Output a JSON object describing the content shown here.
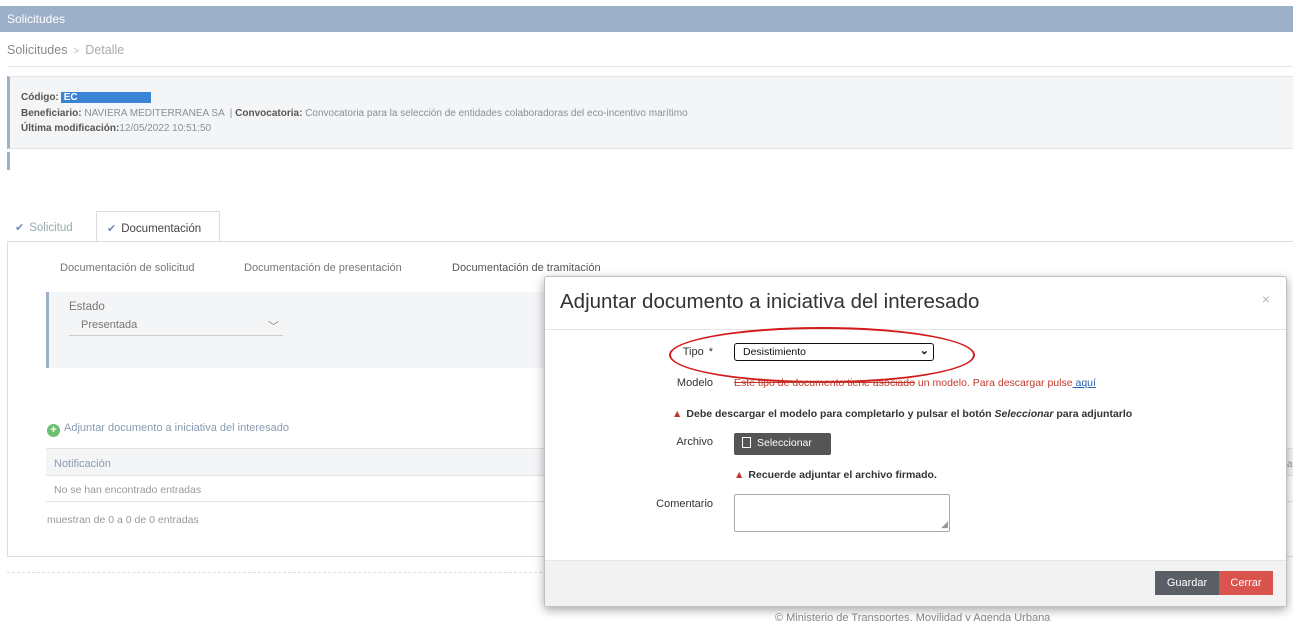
{
  "header": {
    "title": "Solicitudes"
  },
  "breadcrumb": {
    "root": "Solicitudes",
    "separator": ">",
    "current": "Detalle"
  },
  "info": {
    "codigo_label": "Código:",
    "codigo_value": "EC",
    "beneficiario_label": "Beneficiario:",
    "beneficiario_value": "NAVIERA MEDITERRANEA SA",
    "convocatoria_sep": "|",
    "convocatoria_label": "Convocatoria:",
    "convocatoria_value": "Convocatoria para la selección de entidades colaboradoras del eco-incentivo marítimo",
    "modificacion_label": "Última modificación:",
    "modificacion_value": "12/05/2022 10:51:50"
  },
  "tabs": [
    {
      "label": "Solicitud"
    },
    {
      "label": "Documentación"
    }
  ],
  "subtabs": [
    "Documentación de solicitud",
    "Documentación de presentación",
    "Documentación de tramitación"
  ],
  "estado": {
    "label": "Estado",
    "value": "Presentada"
  },
  "attach_link": "Adjuntar documento a iniciativa del interesado",
  "table": {
    "column": "Notificación",
    "empty": "No se han encontrado entradas",
    "info": "muestran de 0 a 0 de 0 entradas",
    "clipped_right": "a"
  },
  "footer": "© Ministerio de Transportes, Movilidad y Agenda Urbana",
  "modal": {
    "title": "Adjuntar documento a iniciativa del interesado",
    "close": "×",
    "tipo_label": "Tipo",
    "required_mark": "*",
    "tipo_value": "Desistimiento",
    "modelo_label": "Modelo",
    "modelo_text_struck": "Este tipo de documento tiene asociado",
    "modelo_text": " un modelo. Para descargar pulse",
    "modelo_link": " aquí",
    "warn1_pre": "Debe descargar el modelo para completarlo y pulsar el botón ",
    "warn1_em": "Seleccionar",
    "warn1_post": " para adjuntarlo",
    "archivo_label": "Archivo",
    "select_button": "Seleccionar",
    "warn2": "Recuerde adjuntar el archivo firmado.",
    "comentario_label": "Comentario",
    "comentario_value": "",
    "save_button": "Guardar",
    "close_button": "Cerrar"
  },
  "colors": {
    "header": "#9cb0c9",
    "danger": "#d9534f",
    "annotation": "#d41a1a",
    "link": "#2a62b0"
  }
}
